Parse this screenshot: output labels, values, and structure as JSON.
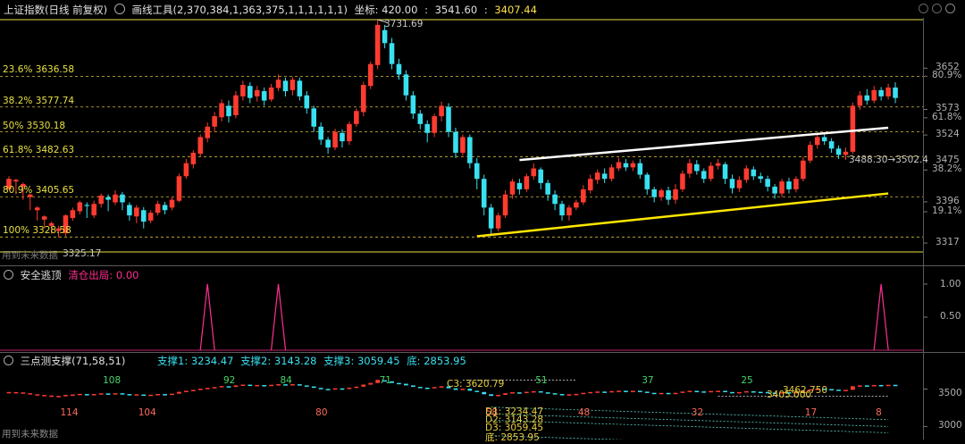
{
  "header": {
    "title": "上证指数(日线 前复权)",
    "tool_label": "画线工具(2,370,384,1,363,375,1,1,1,1,1,1)",
    "coord_label": "坐标: 420.00",
    "value_a": "3541.60",
    "value_b": "3407.44"
  },
  "main": {
    "high_label": "3731.69",
    "low_label": "3325.17",
    "low_prefix": "用到未来数据",
    "channel_label": "3488.30→3502.4",
    "fib_levels": [
      {
        "label": "23.6% 3636.58",
        "value": 3636.58
      },
      {
        "label": "38.2% 3577.74",
        "value": 3577.74
      },
      {
        "label": "50% 3530.18",
        "value": 3530.18
      },
      {
        "label": "61.8% 3482.63",
        "value": 3482.63
      },
      {
        "label": "80.9% 3405.65",
        "value": 3405.65
      },
      {
        "label": "100% 3328.58",
        "value": 3328.58
      }
    ],
    "right_axis": [
      {
        "text": "3652",
        "value": 3652
      },
      {
        "text": "80.9%",
        "value": 3636.58
      },
      {
        "text": "3573",
        "value": 3573
      },
      {
        "text": "61.8%",
        "value": 3557
      },
      {
        "text": "3524",
        "value": 3524
      },
      {
        "text": "3475",
        "value": 3475
      },
      {
        "text": "38.2%",
        "value": 3457
      },
      {
        "text": "3396",
        "value": 3396
      },
      {
        "text": "19.1%",
        "value": 3377
      },
      {
        "text": "3317",
        "value": 3317
      }
    ]
  },
  "pane2": {
    "title": "安全逃顶",
    "series_label": "清仓出局: 0.00",
    "axis": [
      "1.00",
      "0.50"
    ],
    "color": "#ff2e8f"
  },
  "pane3": {
    "title": "三点测支撑(71,58,51)",
    "support1": "支撑1: 3234.47",
    "support2": "支撑2: 3143.28",
    "support3": "支撑3: 3059.45",
    "bottom": "底: 2853.95",
    "axis": [
      "3500",
      "3000"
    ],
    "footer": "用到未来数据",
    "c3": "C3: 3620.79",
    "d1": "D1: 3234.47",
    "d2": "D2: 3143.28",
    "d3": "D3: 3059.45",
    "di": "底: 2853.95",
    "mid_label": "3405.000",
    "mid_label2": "3462.750",
    "numbers_below": [
      {
        "text": "114",
        "i": 8
      },
      {
        "text": "104",
        "i": 19
      },
      {
        "text": "80",
        "i": 44
      },
      {
        "text": "58",
        "i": 68
      },
      {
        "text": "48",
        "i": 81
      },
      {
        "text": "32",
        "i": 97
      },
      {
        "text": "17",
        "i": 113
      },
      {
        "text": "8",
        "i": 123
      }
    ],
    "numbers_above": [
      {
        "text": "108",
        "i": 14
      },
      {
        "text": "92",
        "i": 31
      },
      {
        "text": "84",
        "i": 39
      },
      {
        "text": "71",
        "i": 53
      },
      {
        "text": "51",
        "i": 75
      },
      {
        "text": "37",
        "i": 90
      },
      {
        "text": "25",
        "i": 104
      }
    ]
  },
  "chart_data": {
    "type": "candlestick",
    "title": "上证指数(日线 前复权)",
    "ylim": [
      3300,
      3745
    ],
    "candles": [
      [
        3420,
        3440,
        3425,
        3445
      ],
      [
        3435,
        3438,
        3410,
        3440
      ],
      [
        3425,
        3430,
        3400,
        3433
      ],
      [
        3405,
        3410,
        3380,
        3412
      ],
      [
        3380,
        3385,
        3360,
        3388
      ],
      [
        3362,
        3368,
        3345,
        3370
      ],
      [
        3350,
        3355,
        3335,
        3358
      ],
      [
        3340,
        3345,
        3328,
        3350
      ],
      [
        3336,
        3370,
        3330,
        3372
      ],
      [
        3365,
        3380,
        3360,
        3385
      ],
      [
        3378,
        3395,
        3372,
        3398
      ],
      [
        3390,
        3388,
        3365,
        3395
      ],
      [
        3370,
        3392,
        3365,
        3398
      ],
      [
        3392,
        3408,
        3385,
        3412
      ],
      [
        3405,
        3400,
        3378,
        3410
      ],
      [
        3395,
        3410,
        3390,
        3418
      ],
      [
        3410,
        3395,
        3380,
        3415
      ],
      [
        3390,
        3370,
        3360,
        3395
      ],
      [
        3368,
        3385,
        3355,
        3390
      ],
      [
        3380,
        3358,
        3345,
        3386
      ],
      [
        3360,
        3375,
        3355,
        3380
      ],
      [
        3375,
        3392,
        3370,
        3398
      ],
      [
        3390,
        3380,
        3372,
        3396
      ],
      [
        3385,
        3400,
        3380,
        3406
      ],
      [
        3398,
        3445,
        3395,
        3450
      ],
      [
        3445,
        3470,
        3440,
        3478
      ],
      [
        3468,
        3490,
        3460,
        3495
      ],
      [
        3488,
        3520,
        3482,
        3525
      ],
      [
        3518,
        3540,
        3510,
        3548
      ],
      [
        3540,
        3560,
        3530,
        3568
      ],
      [
        3558,
        3585,
        3550,
        3592
      ],
      [
        3580,
        3560,
        3548,
        3590
      ],
      [
        3562,
        3600,
        3556,
        3608
      ],
      [
        3598,
        3620,
        3590,
        3628
      ],
      [
        3618,
        3595,
        3585,
        3625
      ],
      [
        3598,
        3610,
        3588,
        3618
      ],
      [
        3608,
        3590,
        3580,
        3615
      ],
      [
        3592,
        3615,
        3588,
        3622
      ],
      [
        3614,
        3630,
        3608,
        3640
      ],
      [
        3628,
        3608,
        3598,
        3634
      ],
      [
        3610,
        3630,
        3600,
        3635
      ],
      [
        3628,
        3598,
        3590,
        3634
      ],
      [
        3600,
        3575,
        3565,
        3608
      ],
      [
        3575,
        3540,
        3530,
        3580
      ],
      [
        3540,
        3515,
        3505,
        3548
      ],
      [
        3515,
        3500,
        3488,
        3520
      ],
      [
        3500,
        3530,
        3495,
        3536
      ],
      [
        3528,
        3512,
        3500,
        3535
      ],
      [
        3512,
        3545,
        3505,
        3550
      ],
      [
        3545,
        3570,
        3540,
        3575
      ],
      [
        3568,
        3620,
        3560,
        3626
      ],
      [
        3618,
        3660,
        3612,
        3665
      ],
      [
        3658,
        3735,
        3650,
        3745
      ],
      [
        3725,
        3700,
        3690,
        3735
      ],
      [
        3700,
        3660,
        3650,
        3710
      ],
      [
        3660,
        3640,
        3630,
        3670
      ],
      [
        3640,
        3600,
        3590,
        3648
      ],
      [
        3600,
        3565,
        3555,
        3608
      ],
      [
        3565,
        3545,
        3535,
        3572
      ],
      [
        3545,
        3528,
        3510,
        3552
      ],
      [
        3528,
        3560,
        3520,
        3565
      ],
      [
        3560,
        3580,
        3550,
        3588
      ],
      [
        3578,
        3530,
        3520,
        3585
      ],
      [
        3530,
        3490,
        3480,
        3538
      ],
      [
        3490,
        3520,
        3485,
        3525
      ],
      [
        3520,
        3470,
        3460,
        3525
      ],
      [
        3470,
        3440,
        3420,
        3480
      ],
      [
        3440,
        3385,
        3370,
        3448
      ],
      [
        3385,
        3345,
        3330,
        3392
      ],
      [
        3345,
        3370,
        3340,
        3375
      ],
      [
        3370,
        3410,
        3365,
        3418
      ],
      [
        3410,
        3435,
        3402,
        3440
      ],
      [
        3432,
        3420,
        3410,
        3440
      ],
      [
        3420,
        3445,
        3415,
        3450
      ],
      [
        3445,
        3460,
        3438,
        3470
      ],
      [
        3458,
        3432,
        3420,
        3462
      ],
      [
        3432,
        3410,
        3398,
        3438
      ],
      [
        3410,
        3392,
        3380,
        3418
      ],
      [
        3392,
        3370,
        3360,
        3398
      ],
      [
        3370,
        3385,
        3360,
        3390
      ],
      [
        3385,
        3395,
        3380,
        3400
      ],
      [
        3395,
        3420,
        3390,
        3428
      ],
      [
        3418,
        3440,
        3412,
        3448
      ],
      [
        3438,
        3452,
        3430,
        3458
      ],
      [
        3450,
        3440,
        3432,
        3460
      ],
      [
        3440,
        3462,
        3435,
        3468
      ],
      [
        3460,
        3472,
        3455,
        3480
      ],
      [
        3470,
        3462,
        3455,
        3478
      ],
      [
        3462,
        3470,
        3455,
        3475
      ],
      [
        3470,
        3448,
        3440,
        3478
      ],
      [
        3448,
        3420,
        3410,
        3452
      ],
      [
        3420,
        3405,
        3395,
        3425
      ],
      [
        3405,
        3418,
        3398,
        3422
      ],
      [
        3418,
        3400,
        3390,
        3425
      ],
      [
        3400,
        3420,
        3392,
        3430
      ],
      [
        3420,
        3450,
        3415,
        3456
      ],
      [
        3450,
        3470,
        3442,
        3478
      ],
      [
        3468,
        3455,
        3448,
        3476
      ],
      [
        3455,
        3440,
        3432,
        3460
      ],
      [
        3440,
        3465,
        3435,
        3472
      ],
      [
        3465,
        3470,
        3458,
        3478
      ],
      [
        3468,
        3440,
        3430,
        3472
      ],
      [
        3440,
        3422,
        3412,
        3448
      ],
      [
        3422,
        3438,
        3415,
        3445
      ],
      [
        3438,
        3460,
        3432,
        3466
      ],
      [
        3458,
        3445,
        3438,
        3464
      ],
      [
        3445,
        3440,
        3432,
        3452
      ],
      [
        3440,
        3425,
        3416,
        3446
      ],
      [
        3425,
        3412,
        3402,
        3430
      ],
      [
        3412,
        3435,
        3405,
        3440
      ],
      [
        3435,
        3420,
        3412,
        3442
      ],
      [
        3420,
        3440,
        3414,
        3445
      ],
      [
        3440,
        3475,
        3435,
        3482
      ],
      [
        3475,
        3505,
        3470,
        3512
      ],
      [
        3505,
        3520,
        3498,
        3526
      ],
      [
        3520,
        3512,
        3505,
        3526
      ],
      [
        3512,
        3498,
        3490,
        3518
      ],
      [
        3498,
        3486,
        3478,
        3504
      ],
      [
        3486,
        3492,
        3476,
        3500
      ],
      [
        3492,
        3580,
        3488,
        3586
      ],
      [
        3580,
        3600,
        3572,
        3608
      ],
      [
        3600,
        3590,
        3582,
        3612
      ],
      [
        3590,
        3610,
        3585,
        3618
      ],
      [
        3610,
        3598,
        3590,
        3616
      ],
      [
        3598,
        3615,
        3592,
        3622
      ],
      [
        3615,
        3595,
        3585,
        3625
      ]
    ]
  }
}
